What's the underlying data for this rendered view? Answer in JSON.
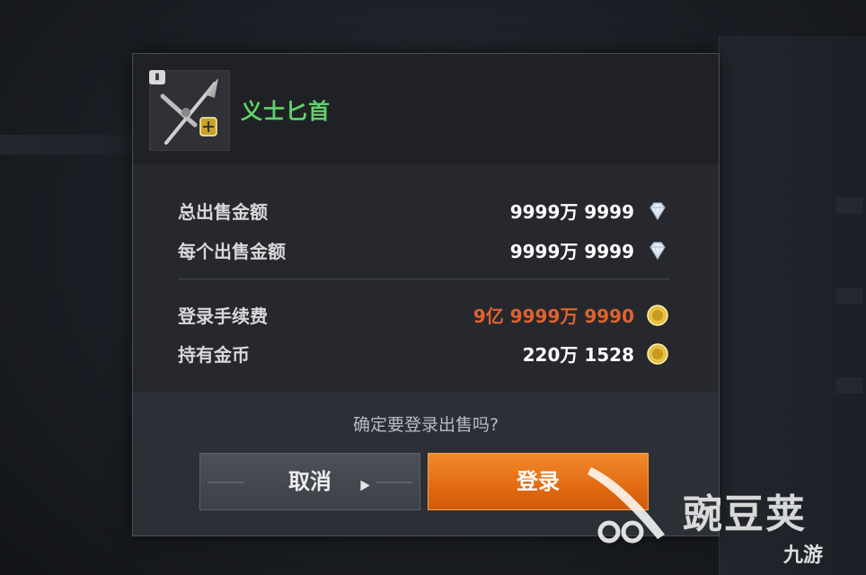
{
  "dialog": {
    "item": {
      "name": "义士匕首",
      "name_color": "#5fd36a",
      "icon": "dagger-icon",
      "badge_icon": "book-icon"
    },
    "rows": [
      {
        "label": "总出售金额",
        "value": "9999万 9999",
        "currency_icon": "diamond-icon"
      },
      {
        "label": "每个出售金额",
        "value": "9999万 9999",
        "currency_icon": "diamond-icon"
      },
      {
        "label": "登录手续费",
        "value": "9亿 9999万 9990",
        "currency_icon": "gold-coin-icon",
        "value_color": "#e0622e"
      },
      {
        "label": "持有金币",
        "value": "220万 1528",
        "currency_icon": "gold-coin-icon"
      }
    ],
    "confirm_text": "确定要登录出售吗?",
    "buttons": {
      "cancel": "取消",
      "login": "登录"
    },
    "accent_color": "#e8761a"
  },
  "watermark": {
    "brand": "豌豆荚",
    "sub_brand": "九游"
  }
}
